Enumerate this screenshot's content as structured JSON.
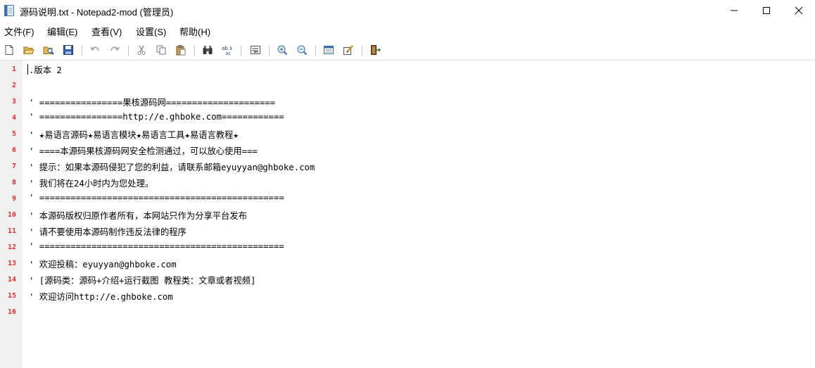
{
  "window": {
    "title": "源码说明.txt - Notepad2-mod (管理员)",
    "icon": "notepad-doc-icon"
  },
  "menu": [
    "文件(F)",
    "编辑(E)",
    "查看(V)",
    "设置(S)",
    "帮助(H)"
  ],
  "toolbar": {
    "buttons": [
      "new-file",
      "open-file",
      "browse",
      "save",
      "undo",
      "redo",
      "cut",
      "copy",
      "paste",
      "find",
      "replace",
      "word-wrap",
      "zoom-in",
      "zoom-out",
      "scheme",
      "customize-scheme",
      "exit"
    ]
  },
  "editor": {
    "lines": [
      {
        "no": "1",
        "text": ".版本 2"
      },
      {
        "no": "2",
        "text": ""
      },
      {
        "no": "3",
        "text": "' ================果核源码网====================="
      },
      {
        "no": "4",
        "text": "' ================http://e.ghboke.com============"
      },
      {
        "no": "5",
        "text": "' ★易语言源码★易语言模块★易语言工具★易语言教程★"
      },
      {
        "no": "6",
        "text": "' ====本源码果核源码网安全检测通过，可以放心使用==="
      },
      {
        "no": "7",
        "text": "' 提示：如果本源码侵犯了您的利益，请联系邮箱eyuyyan@ghboke.com"
      },
      {
        "no": "8",
        "text": "' 我们将在24小时内为您处理。"
      },
      {
        "no": "9",
        "text": "' ==============================================="
      },
      {
        "no": "10",
        "text": "' 本源码版权归原作者所有，本网站只作为分享平台发布"
      },
      {
        "no": "11",
        "text": "' 请不要使用本源码制作违反法律的程序"
      },
      {
        "no": "12",
        "text": "' ==============================================="
      },
      {
        "no": "13",
        "text": "' 欢迎投稿：eyuyyan@ghboke.com"
      },
      {
        "no": "14",
        "text": "' [源码类：源码+介绍+运行截图 教程类：文章或者视频]"
      },
      {
        "no": "15",
        "text": "' 欢迎访问http://e.ghboke.com"
      },
      {
        "no": "16",
        "text": ""
      }
    ]
  },
  "colors": {
    "line_number": "#e03030",
    "gutter": "#f0f0f0",
    "text": "#000000"
  }
}
